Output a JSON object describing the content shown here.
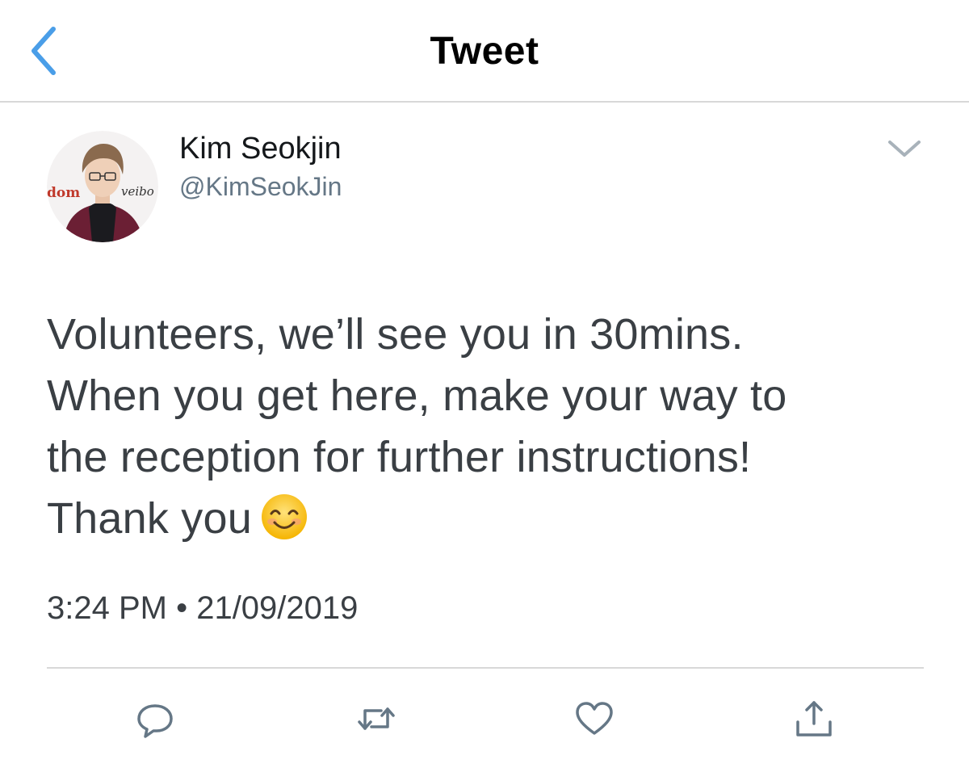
{
  "header": {
    "title": "Tweet",
    "back_icon": "chevron-left-icon",
    "accent_color": "#4a9ee8"
  },
  "author": {
    "name": "Kim Seokjin",
    "handle": "@KimSeokJin",
    "avatar_icon": "avatar-photo",
    "avatar_background_text_left": "dom",
    "avatar_background_text_right": "veibo"
  },
  "tweet": {
    "text": "Volunteers, we’ll see you in 30mins.\nWhen you get here, make your way to\nthe reception for further instructions!\nThank you",
    "emoji_icon": "smiling-face-emoji",
    "timestamp": "3:24 PM • 21/09/2019"
  },
  "actions": {
    "reply_icon": "reply-icon",
    "retweet_icon": "retweet-icon",
    "like_icon": "heart-icon",
    "share_icon": "share-icon"
  },
  "colors": {
    "text_primary": "#14171a",
    "text_secondary": "#657786",
    "icon_gray": "#657786",
    "divider": "#d8d8d8"
  }
}
